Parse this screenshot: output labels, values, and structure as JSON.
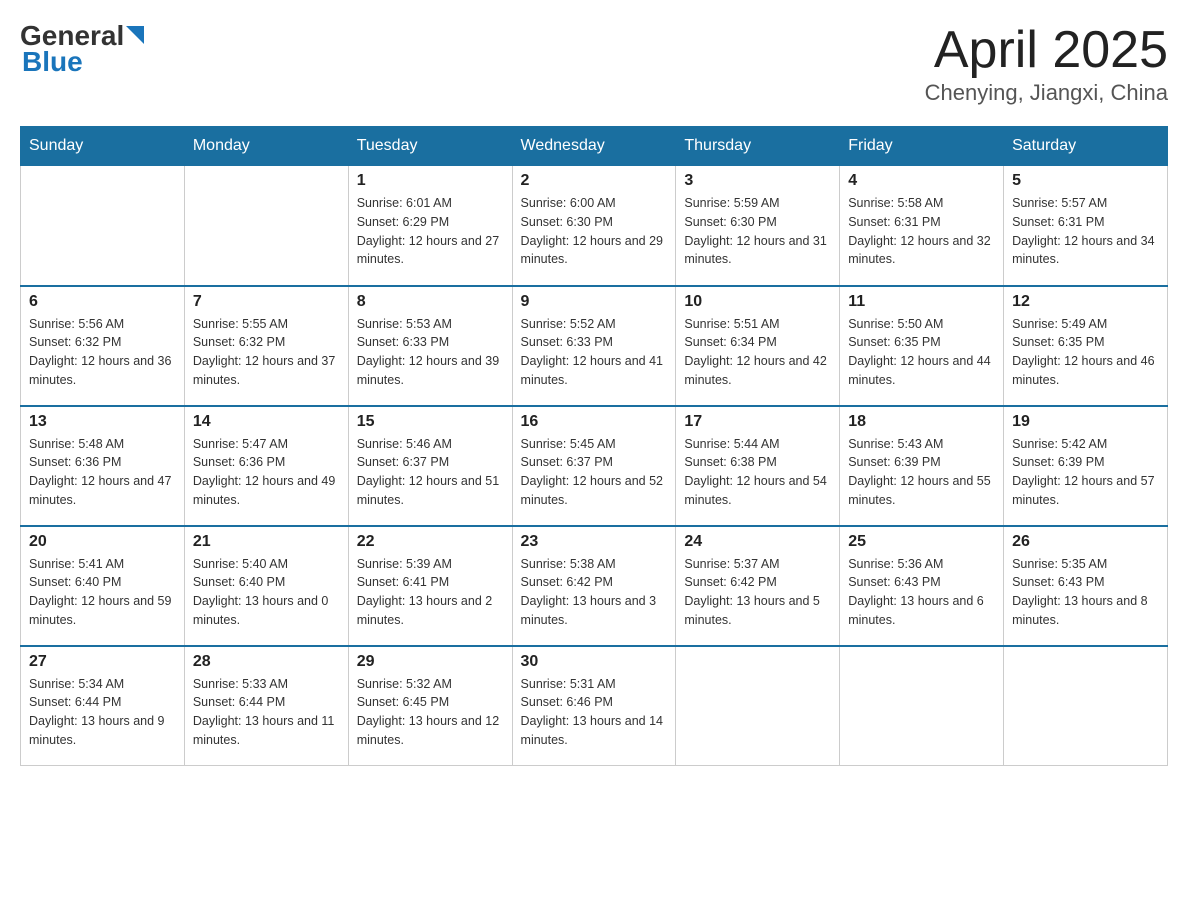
{
  "header": {
    "logo": {
      "text_general": "General",
      "text_blue": "Blue",
      "arrow": "▶"
    },
    "title": "April 2025",
    "location": "Chenying, Jiangxi, China"
  },
  "columns": [
    "Sunday",
    "Monday",
    "Tuesday",
    "Wednesday",
    "Thursday",
    "Friday",
    "Saturday"
  ],
  "weeks": [
    [
      {
        "day": "",
        "sunrise": "",
        "sunset": "",
        "daylight": ""
      },
      {
        "day": "",
        "sunrise": "",
        "sunset": "",
        "daylight": ""
      },
      {
        "day": "1",
        "sunrise": "Sunrise: 6:01 AM",
        "sunset": "Sunset: 6:29 PM",
        "daylight": "Daylight: 12 hours and 27 minutes."
      },
      {
        "day": "2",
        "sunrise": "Sunrise: 6:00 AM",
        "sunset": "Sunset: 6:30 PM",
        "daylight": "Daylight: 12 hours and 29 minutes."
      },
      {
        "day": "3",
        "sunrise": "Sunrise: 5:59 AM",
        "sunset": "Sunset: 6:30 PM",
        "daylight": "Daylight: 12 hours and 31 minutes."
      },
      {
        "day": "4",
        "sunrise": "Sunrise: 5:58 AM",
        "sunset": "Sunset: 6:31 PM",
        "daylight": "Daylight: 12 hours and 32 minutes."
      },
      {
        "day": "5",
        "sunrise": "Sunrise: 5:57 AM",
        "sunset": "Sunset: 6:31 PM",
        "daylight": "Daylight: 12 hours and 34 minutes."
      }
    ],
    [
      {
        "day": "6",
        "sunrise": "Sunrise: 5:56 AM",
        "sunset": "Sunset: 6:32 PM",
        "daylight": "Daylight: 12 hours and 36 minutes."
      },
      {
        "day": "7",
        "sunrise": "Sunrise: 5:55 AM",
        "sunset": "Sunset: 6:32 PM",
        "daylight": "Daylight: 12 hours and 37 minutes."
      },
      {
        "day": "8",
        "sunrise": "Sunrise: 5:53 AM",
        "sunset": "Sunset: 6:33 PM",
        "daylight": "Daylight: 12 hours and 39 minutes."
      },
      {
        "day": "9",
        "sunrise": "Sunrise: 5:52 AM",
        "sunset": "Sunset: 6:33 PM",
        "daylight": "Daylight: 12 hours and 41 minutes."
      },
      {
        "day": "10",
        "sunrise": "Sunrise: 5:51 AM",
        "sunset": "Sunset: 6:34 PM",
        "daylight": "Daylight: 12 hours and 42 minutes."
      },
      {
        "day": "11",
        "sunrise": "Sunrise: 5:50 AM",
        "sunset": "Sunset: 6:35 PM",
        "daylight": "Daylight: 12 hours and 44 minutes."
      },
      {
        "day": "12",
        "sunrise": "Sunrise: 5:49 AM",
        "sunset": "Sunset: 6:35 PM",
        "daylight": "Daylight: 12 hours and 46 minutes."
      }
    ],
    [
      {
        "day": "13",
        "sunrise": "Sunrise: 5:48 AM",
        "sunset": "Sunset: 6:36 PM",
        "daylight": "Daylight: 12 hours and 47 minutes."
      },
      {
        "day": "14",
        "sunrise": "Sunrise: 5:47 AM",
        "sunset": "Sunset: 6:36 PM",
        "daylight": "Daylight: 12 hours and 49 minutes."
      },
      {
        "day": "15",
        "sunrise": "Sunrise: 5:46 AM",
        "sunset": "Sunset: 6:37 PM",
        "daylight": "Daylight: 12 hours and 51 minutes."
      },
      {
        "day": "16",
        "sunrise": "Sunrise: 5:45 AM",
        "sunset": "Sunset: 6:37 PM",
        "daylight": "Daylight: 12 hours and 52 minutes."
      },
      {
        "day": "17",
        "sunrise": "Sunrise: 5:44 AM",
        "sunset": "Sunset: 6:38 PM",
        "daylight": "Daylight: 12 hours and 54 minutes."
      },
      {
        "day": "18",
        "sunrise": "Sunrise: 5:43 AM",
        "sunset": "Sunset: 6:39 PM",
        "daylight": "Daylight: 12 hours and 55 minutes."
      },
      {
        "day": "19",
        "sunrise": "Sunrise: 5:42 AM",
        "sunset": "Sunset: 6:39 PM",
        "daylight": "Daylight: 12 hours and 57 minutes."
      }
    ],
    [
      {
        "day": "20",
        "sunrise": "Sunrise: 5:41 AM",
        "sunset": "Sunset: 6:40 PM",
        "daylight": "Daylight: 12 hours and 59 minutes."
      },
      {
        "day": "21",
        "sunrise": "Sunrise: 5:40 AM",
        "sunset": "Sunset: 6:40 PM",
        "daylight": "Daylight: 13 hours and 0 minutes."
      },
      {
        "day": "22",
        "sunrise": "Sunrise: 5:39 AM",
        "sunset": "Sunset: 6:41 PM",
        "daylight": "Daylight: 13 hours and 2 minutes."
      },
      {
        "day": "23",
        "sunrise": "Sunrise: 5:38 AM",
        "sunset": "Sunset: 6:42 PM",
        "daylight": "Daylight: 13 hours and 3 minutes."
      },
      {
        "day": "24",
        "sunrise": "Sunrise: 5:37 AM",
        "sunset": "Sunset: 6:42 PM",
        "daylight": "Daylight: 13 hours and 5 minutes."
      },
      {
        "day": "25",
        "sunrise": "Sunrise: 5:36 AM",
        "sunset": "Sunset: 6:43 PM",
        "daylight": "Daylight: 13 hours and 6 minutes."
      },
      {
        "day": "26",
        "sunrise": "Sunrise: 5:35 AM",
        "sunset": "Sunset: 6:43 PM",
        "daylight": "Daylight: 13 hours and 8 minutes."
      }
    ],
    [
      {
        "day": "27",
        "sunrise": "Sunrise: 5:34 AM",
        "sunset": "Sunset: 6:44 PM",
        "daylight": "Daylight: 13 hours and 9 minutes."
      },
      {
        "day": "28",
        "sunrise": "Sunrise: 5:33 AM",
        "sunset": "Sunset: 6:44 PM",
        "daylight": "Daylight: 13 hours and 11 minutes."
      },
      {
        "day": "29",
        "sunrise": "Sunrise: 5:32 AM",
        "sunset": "Sunset: 6:45 PM",
        "daylight": "Daylight: 13 hours and 12 minutes."
      },
      {
        "day": "30",
        "sunrise": "Sunrise: 5:31 AM",
        "sunset": "Sunset: 6:46 PM",
        "daylight": "Daylight: 13 hours and 14 minutes."
      },
      {
        "day": "",
        "sunrise": "",
        "sunset": "",
        "daylight": ""
      },
      {
        "day": "",
        "sunrise": "",
        "sunset": "",
        "daylight": ""
      },
      {
        "day": "",
        "sunrise": "",
        "sunset": "",
        "daylight": ""
      }
    ]
  ]
}
